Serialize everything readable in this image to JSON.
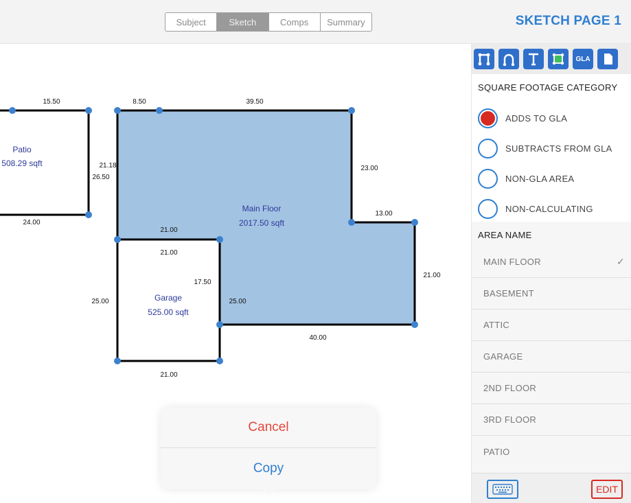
{
  "header": {
    "tabs": [
      {
        "label": "Subject",
        "active": false
      },
      {
        "label": "Sketch",
        "active": true
      },
      {
        "label": "Comps",
        "active": false
      },
      {
        "label": "Summary",
        "active": false
      }
    ],
    "page_title": "SKETCH PAGE 1"
  },
  "sketch": {
    "rooms": [
      {
        "name": "Patio",
        "area": "508.29 sqft"
      },
      {
        "name": "Main Floor",
        "area": "2017.50 sqft"
      },
      {
        "name": "Garage",
        "area": "525.00 sqft"
      }
    ],
    "dimensions": {
      "patio_top": "15.50",
      "patio_bottom": "24.00",
      "patio_right_a": "21.18",
      "patio_right_b": "26.50",
      "main_top_a": "8.50",
      "main_top_b": "39.50",
      "main_right_upper": "23.00",
      "main_step": "13.00",
      "main_right_lower": "21.00",
      "main_bottom": "40.00",
      "main_inner": "25.00",
      "garage_top_outer": "21.00",
      "garage_top_inner": "21.00",
      "garage_right": "17.50",
      "garage_left": "25.00",
      "garage_bottom": "21.00"
    },
    "colors": {
      "fill": "#a3c3e2",
      "vertex": "#3c82cf",
      "line": "#000000"
    }
  },
  "action_sheet": {
    "cancel_label": "Cancel",
    "copy_label": "Copy"
  },
  "panel": {
    "tools": [
      "polyline-tool-icon",
      "arc-tool-icon",
      "text-tool-icon",
      "area-tool-icon",
      "GLA",
      "page-icon"
    ],
    "gla_label": "GLA",
    "category_title": "SQUARE FOOTAGE CATEGORY",
    "categories": [
      {
        "label": "ADDS TO GLA",
        "selected": true
      },
      {
        "label": "SUBTRACTS FROM GLA",
        "selected": false
      },
      {
        "label": "NON-GLA AREA",
        "selected": false
      },
      {
        "label": "NON-CALCULATING",
        "selected": false
      }
    ],
    "area_title": "AREA NAME",
    "area_names": [
      {
        "label": "MAIN FLOOR",
        "checked": true
      },
      {
        "label": "BASEMENT",
        "checked": false
      },
      {
        "label": "ATTIC",
        "checked": false
      },
      {
        "label": "GARAGE",
        "checked": false
      },
      {
        "label": "2ND FLOOR",
        "checked": false
      },
      {
        "label": "3RD FLOOR",
        "checked": false
      },
      {
        "label": "PATIO",
        "checked": false
      }
    ],
    "check_mark": "✓",
    "edit_label": "EDIT"
  }
}
